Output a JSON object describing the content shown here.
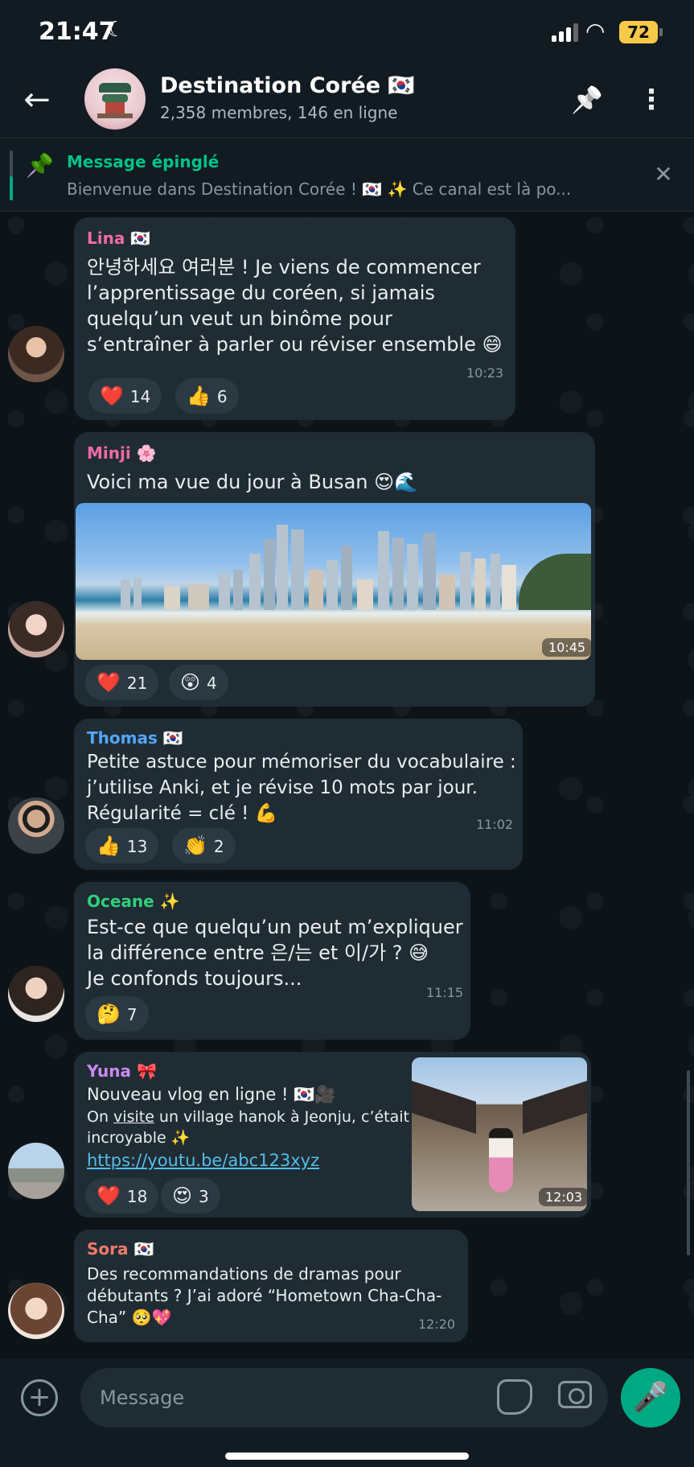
{
  "status_bar": {
    "time": "21:47",
    "moon_icon": "☾",
    "wifi_icon": "◠",
    "battery": "72"
  },
  "header": {
    "back_icon": "←",
    "title": "Destination Corée 🇰🇷",
    "subtitle": "2,358 membres, 146 en ligne",
    "pin_icon": "📌",
    "more_icon": "⋮"
  },
  "pinned": {
    "icon": "📌",
    "title": "Message épinglé",
    "text": "Bienvenue dans Destination Corée ! 🇰🇷 ✨ Ce canal est là po...",
    "close_icon": "✕"
  },
  "messages": [
    {
      "sender": "Lina 🇰🇷",
      "sender_color": "#f06aa7",
      "lines": [
        "안녕하세요 여러분 ! Je viens de commencer",
        "l’apprentissage du coréen, si jamais",
        "quelqu’un veut un binôme pour",
        "s’entraîner à parler ou réviser ensemble 😄"
      ],
      "time": "10:23",
      "reactions": [
        {
          "emoji": "❤️",
          "count": "14"
        },
        {
          "emoji": "👍",
          "count": "6"
        }
      ]
    },
    {
      "sender": "Minji 🌸",
      "sender_color": "#f06aa7",
      "text": "Voici ma vue du jour à Busan 😍🌊",
      "time": "10:45",
      "reactions": [
        {
          "emoji": "❤️",
          "count": "21"
        },
        {
          "emoji": "😲",
          "count": "4"
        }
      ]
    },
    {
      "sender": "Thomas  🇰🇷",
      "sender_color": "#53a6ff",
      "lines": [
        "Petite astuce pour mémoriser du vocabulaire :",
        "j’utilise Anki, et je révise 10 mots par jour.",
        "Régularité = clé ! 💪"
      ],
      "time": "11:02",
      "reactions": [
        {
          "emoji": "👍",
          "count": "13"
        },
        {
          "emoji": "👏",
          "count": "2"
        }
      ]
    },
    {
      "sender": "Oceane ✨",
      "sender_color": "#2fd07a",
      "lines": [
        "Est-ce que quelqu’un peut m’expliquer",
        "la différence entre 은/는 et 이/가 ? 😅",
        "Je confonds toujours..."
      ],
      "time": "11:15",
      "reactions": [
        {
          "emoji": "🤔",
          "count": "7"
        }
      ]
    },
    {
      "sender": "Yuna 🎀",
      "sender_color": "#c98bf2",
      "line1": "Nouveau vlog en ligne ! 🇰🇷🎥",
      "line2_a": "On ",
      "line2_b": "visite",
      "line2_c": " un village hanok à Jeonju, c’était",
      "line3": "incroyable ✨",
      "link": "https://youtu.be/abc123xyz",
      "time": "12:03",
      "reactions": [
        {
          "emoji": "❤️",
          "count": "18"
        },
        {
          "emoji": "😍",
          "count": "3"
        }
      ]
    },
    {
      "sender": "Sora 🇰🇷",
      "sender_color": "#f07a6a",
      "lines": [
        "Des recommandations de dramas pour",
        "débutants ? J’ai adoré “Hometown Cha-Cha-",
        "Cha” 🥺💖"
      ],
      "time": "12:20"
    }
  ],
  "input": {
    "placeholder": "Message",
    "add_icon": "+",
    "mic_icon": "🎤"
  },
  "colors": {
    "accent": "#00a884",
    "bubble": "#202c33",
    "background": "#0e1416"
  }
}
